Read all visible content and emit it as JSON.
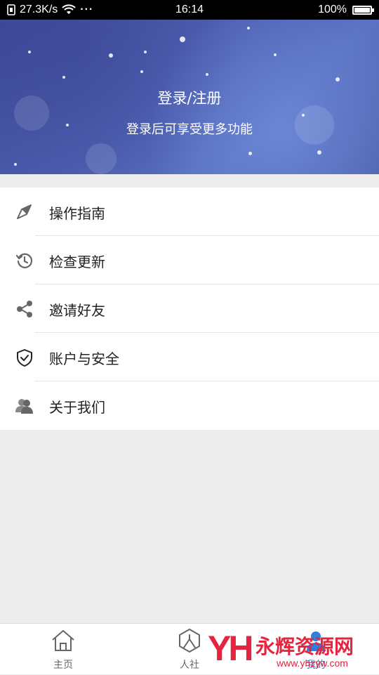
{
  "status_bar": {
    "net_speed": "27.3K/s",
    "more": "···",
    "time": "16:14",
    "battery": "100%",
    "battery_level": 1.0
  },
  "banner": {
    "title": "登录/注册",
    "subtitle": "登录后可享受更多功能"
  },
  "menu": {
    "items": [
      {
        "label": "操作指南",
        "icon": "compass-icon"
      },
      {
        "label": "检查更新",
        "icon": "clock-refresh-icon"
      },
      {
        "label": "邀请好友",
        "icon": "share-icon"
      },
      {
        "label": "账户与安全",
        "icon": "shield-check-icon"
      },
      {
        "label": "关于我们",
        "icon": "users-icon"
      }
    ]
  },
  "bottom_nav": {
    "items": [
      {
        "label": "主页",
        "icon": "home-icon"
      },
      {
        "label": "人社",
        "icon": "person-hexagon-icon"
      },
      {
        "label": "我的",
        "icon": "profile-icon"
      }
    ]
  },
  "watermark": {
    "logo": "YH",
    "text": "永辉资源网",
    "url": "www.yhzyw.com"
  },
  "colors": {
    "accent": "#2f7fdc",
    "banner": "#4e5fb0",
    "watermark": "#e5243f"
  }
}
